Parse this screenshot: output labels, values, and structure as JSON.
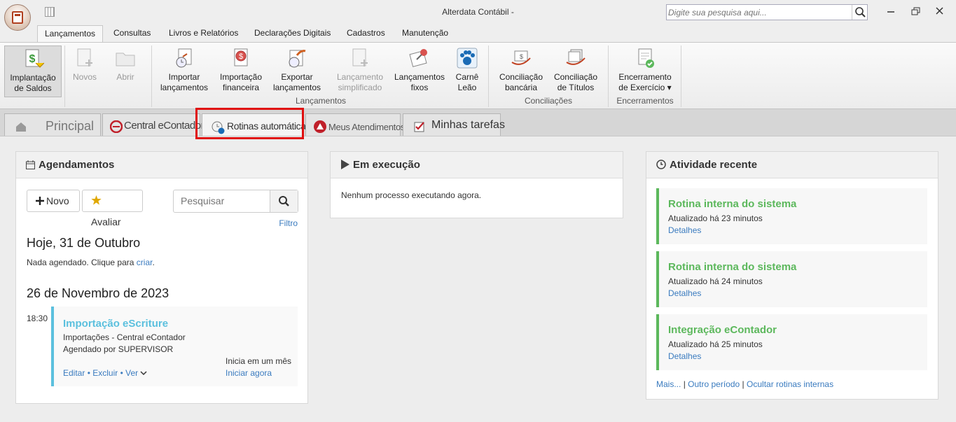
{
  "window": {
    "title": "Alterdata Contábil -",
    "search_placeholder": "Digite sua pesquisa aqui..."
  },
  "ribbon_tabs": [
    "Lançamentos",
    "Consultas",
    "Livros e Relatórios",
    "Declarações Digitais",
    "Cadastros",
    "Manutenção"
  ],
  "ribbon": {
    "implantacao": "Implantação\nde Saldos",
    "novos": "Novos",
    "abrir": "Abrir",
    "importar": "Importar\nlançamentos",
    "importacao_fin": "Importação\nfinanceira",
    "exportar": "Exportar\nlançamentos",
    "lanc_simpl": "Lançamento\nsimplificado",
    "lanc_fixos": "Lançamentos\nfixos",
    "carne": "Carnê\nLeão",
    "conc_bancaria": "Conciliação\nbancária",
    "conc_titulos": "Conciliação\nde Títulos",
    "encerramento": "Encerramento\nde Exercício ▾",
    "group_lancamentos": "Lançamentos",
    "group_conciliacoes": "Conciliações",
    "group_encerramentos": "Encerramentos"
  },
  "doc_tabs": {
    "principal": "Principal",
    "central": "Central eContador",
    "rotinas": "Rotinas automáticas",
    "atendimentos": "Meus Atendimentos",
    "tarefas": "Minhas tarefas"
  },
  "agendamentos": {
    "title": "Agendamentos",
    "novo": "Novo",
    "avaliar": "Avaliar",
    "search_placeholder": "Pesquisar",
    "filtro": "Filtro",
    "today_heading": "Hoje, 31 de Outubro",
    "today_text": "Nada agendado. Clique para ",
    "today_link": "criar",
    "today_end": ".",
    "date_heading": "26 de Novembro de 2023",
    "time": "18:30",
    "event_title": "Importação eScriture",
    "event_line1": "Importações - Central eContador",
    "event_line2": "Agendado por SUPERVISOR",
    "event_start": "Inicia em um mês",
    "editar": "Editar",
    "excluir": "Excluir",
    "ver": "Ver",
    "bullet": "•",
    "iniciar": "Iniciar agora"
  },
  "em_execucao": {
    "title": "Em execução",
    "text": "Nenhum processo executando agora."
  },
  "atividade": {
    "title": "Atividade recente",
    "items": [
      {
        "title": "Rotina interna do sistema",
        "sub": "Atualizado há 23 minutos",
        "link": "Detalhes"
      },
      {
        "title": "Rotina interna do sistema",
        "sub": "Atualizado há 24 minutos",
        "link": "Detalhes"
      },
      {
        "title": "Integração eContador",
        "sub": "Atualizado há 25 minutos",
        "link": "Detalhes"
      }
    ],
    "mais": "Mais...",
    "outro": "Outro período",
    "ocultar": "Ocultar rotinas internas",
    "pipe": "|"
  },
  "colors": {
    "green": "#5cb85c",
    "blue_link": "#3a7bbf",
    "event_accent": "#5bc0de",
    "highlight": "#e01010"
  }
}
